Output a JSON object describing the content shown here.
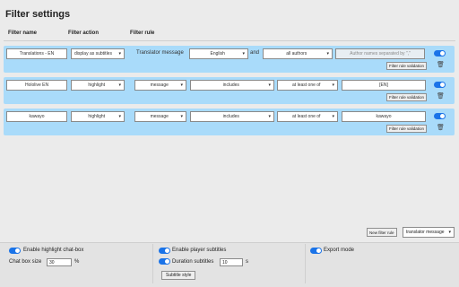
{
  "page": {
    "title": "Filter settings"
  },
  "headers": {
    "name": "Filter name",
    "action": "Filter action",
    "rule": "Filter rule"
  },
  "rules": [
    {
      "name": "Translations - EN",
      "action": "display as subtitles",
      "rule_label": "Translator message",
      "language": "English",
      "conjunction": "and",
      "authors": "all authors",
      "author_placeholder": "Author names separated by \",\"",
      "validation": "Filter rule validation"
    },
    {
      "name": "Hololive EN",
      "action": "highlight",
      "field": "message",
      "operator": "includes",
      "quantifier": "at least one of",
      "value": "[EN]",
      "validation": "Filter rule validation"
    },
    {
      "name": "kawayo",
      "action": "highlight",
      "field": "message",
      "operator": "includes",
      "quantifier": "at least one of",
      "value": "kawayo",
      "validation": "Filter rule validation"
    }
  ],
  "toolbar": {
    "new_rule": "New filter rule",
    "rule_type": "translator message"
  },
  "footer": {
    "highlight_chatbox": "Enable highlight chat-box",
    "chatbox_size_label": "Chat box size",
    "chatbox_size_value": "30",
    "chatbox_size_unit": "%",
    "player_subtitles": "Enable player subtitles",
    "duration_label": "Duration subtitles",
    "duration_value": "10",
    "duration_unit": "s",
    "subtitle_style": "Subtitle style",
    "export_mode": "Export mode"
  },
  "colors": {
    "rule_bg": "#a9dbfa",
    "toggle": "#1a73e8"
  }
}
